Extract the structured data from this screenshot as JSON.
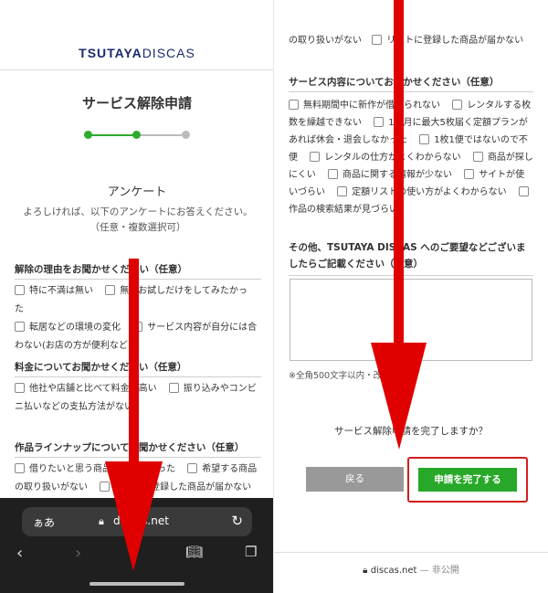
{
  "left": {
    "logo": {
      "brand": "TSUTAYA",
      "product": "DISCAS"
    },
    "page_title": "サービス解除申請",
    "steps": {
      "total": 3,
      "current": 2,
      "color_active": "#2eaa2e",
      "color_inactive": "#bbbbbb"
    },
    "survey_title": "アンケート",
    "survey_desc": "よろしければ、以下のアンケートにお答えください。（任意・複数選択可）",
    "q1": {
      "title": "解除の理由をお聞かせください（任意）",
      "options": [
        "特に不満は無い",
        "無料お試しだけをしてみたかった",
        "転居などの環境の変化",
        "サービス内容が自分には合わない(お店の方が便利など)"
      ]
    },
    "q2": {
      "title": "料金についてお聞かせください（任意）",
      "options": [
        "他社や店舗と比べて料金が高い",
        "振り込みやコンビニ払いなどの支払方法がない"
      ]
    },
    "q3": {
      "title": "作品ラインナップについてお聞かせください（任意）",
      "options": [
        "借りたいと思う商品が貸し中だった",
        "希望する商品の取り扱いがない",
        "リストに登録した商品が届かない"
      ]
    },
    "browser": {
      "aa": "ぁあ",
      "host": "discas.net"
    }
  },
  "right": {
    "top_text": "の取り扱いがない",
    "top_option": "リストに登録した商品が届かない",
    "q4": {
      "title": "サービス内容についてお聞かせください（任意）",
      "options": [
        "無料期間中に新作が借りられない",
        "レンタルする枚数を繰越できない",
        "1ヶ月に最大5枚届く定額プランがあれば休会・退会しなかった",
        "1枚1便ではないので不便",
        "レンタルの仕方がよくわからない",
        "商品が探しにくい",
        "商品に関する情報が少ない",
        "サイトが使いづらい",
        "定額リストの使い方がよくわからない",
        "作品の検索結果が見づらい"
      ]
    },
    "q5_title": "その他、TSUTAYA DISCAS へのご要望などございましたらご記載ください（任意）",
    "note": "※全角500文字以内・改行不可",
    "confirm": "サービス解除申請を完了しますか？",
    "back_label": "戻る",
    "submit_label": "申請を完了する",
    "footer_host": "discas.net",
    "footer_private": "— 非公開"
  },
  "colors": {
    "arrow": "#e00000",
    "highlight": "#d21f1f",
    "submit": "#28a828"
  }
}
